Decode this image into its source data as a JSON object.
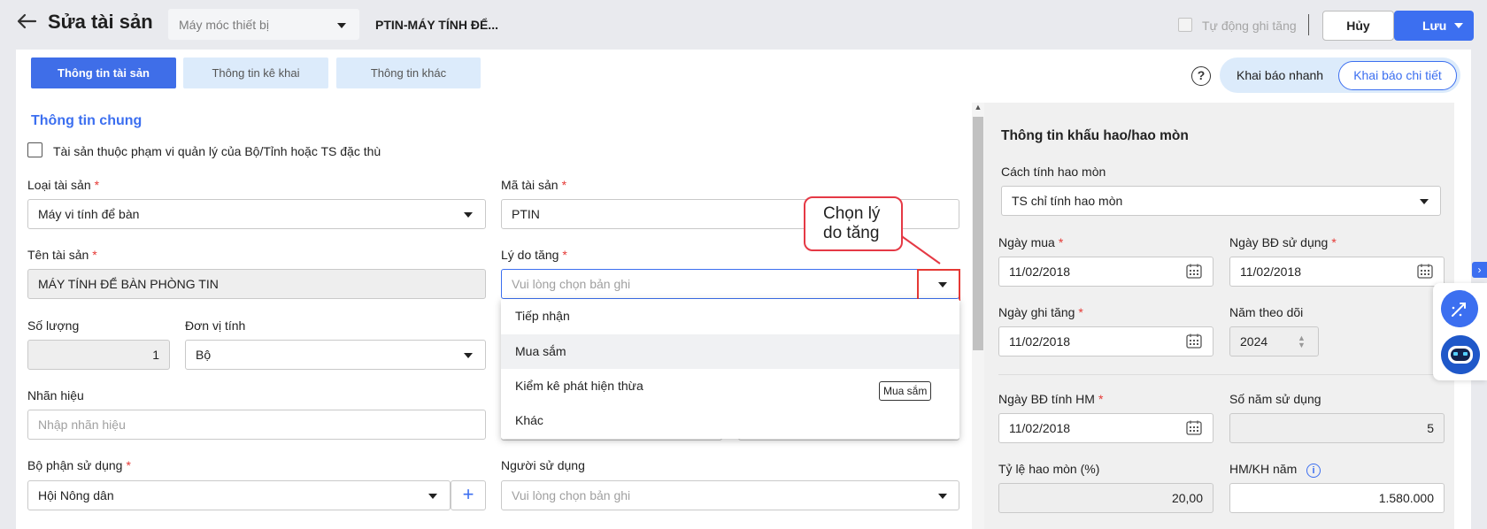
{
  "header": {
    "title": "Sửa tài sản",
    "group_select": "Máy móc thiết bị",
    "asset_code": "PTIN-MÁY TÍNH ĐỂ...",
    "auto_increase_label": "Tự động ghi tăng",
    "cancel_label": "Hủy",
    "save_label": "Lưu"
  },
  "tabs": [
    "Thông tin tài sản",
    "Thông tin kê khai",
    "Thông tin khác"
  ],
  "mode": {
    "quick": "Khai báo nhanh",
    "detail": "Khai báo chi tiết"
  },
  "help": "?",
  "general": {
    "section_title": "Thông tin chung",
    "special_checkbox_label": "Tài sản thuộc phạm vi quản lý của Bộ/Tỉnh hoặc TS đặc thù",
    "asset_type": {
      "label": "Loại tài sản",
      "value": "Máy vi tính để bàn"
    },
    "asset_code": {
      "label": "Mã tài sản",
      "value": "PTIN"
    },
    "asset_name": {
      "label": "Tên tài sản",
      "value": "MÁY TÍNH ĐỂ BÀN PHÒNG TIN"
    },
    "increase_reason": {
      "label": "Lý do tăng",
      "placeholder": "Vui lòng chọn bản ghi"
    },
    "quantity": {
      "label": "Số lượng",
      "value": "1"
    },
    "unit": {
      "label": "Đơn vị tính",
      "value": "Bộ"
    },
    "brand": {
      "label": "Nhãn hiệu",
      "placeholder": "Nhập nhãn hiệu"
    },
    "department": {
      "label": "Bộ phận sử dụng",
      "value": "Hội Nông dân",
      "add": "+"
    },
    "user": {
      "label": "Người sử dụng",
      "placeholder": "Vui lòng chọn bản ghi"
    },
    "required_mark": "*"
  },
  "reason_options": [
    "Tiếp nhận",
    "Mua sắm",
    "Kiểm kê phát hiện thừa",
    "Khác"
  ],
  "tooltip": "Mua sắm",
  "callout": {
    "line1": "Chọn lý",
    "line2": "do tăng"
  },
  "depreciation": {
    "title": "Thông tin khấu hao/hao mòn",
    "method": {
      "label": "Cách tính hao mòn",
      "value": "TS chỉ tính hao mòn"
    },
    "purchase_date": {
      "label": "Ngày mua",
      "value": "11/02/2018"
    },
    "use_start_date": {
      "label": "Ngày BĐ sử dụng",
      "value": "11/02/2018"
    },
    "increase_date": {
      "label": "Ngày ghi tăng",
      "value": "11/02/2018"
    },
    "tracking_year": {
      "label": "Năm theo dõi",
      "value": "2024"
    },
    "dep_start_date": {
      "label": "Ngày BĐ tính HM",
      "value": "11/02/2018"
    },
    "years_of_use": {
      "label": "Số năm sử dụng",
      "value": "5"
    },
    "dep_rate": {
      "label": "Tỷ lệ hao mòn (%)",
      "value": "20,00"
    },
    "dep_per_year": {
      "label": "HM/KH năm",
      "value": "1.580.000"
    }
  },
  "colors": {
    "accent": "#3c6ff0",
    "required": "#e53935",
    "tab_inactive": "#dcebfb"
  },
  "icons": [
    "back-arrow-icon",
    "chevron-down-icon",
    "calendar-icon",
    "info-icon",
    "rocket-icon",
    "robot-icon",
    "help-icon"
  ]
}
